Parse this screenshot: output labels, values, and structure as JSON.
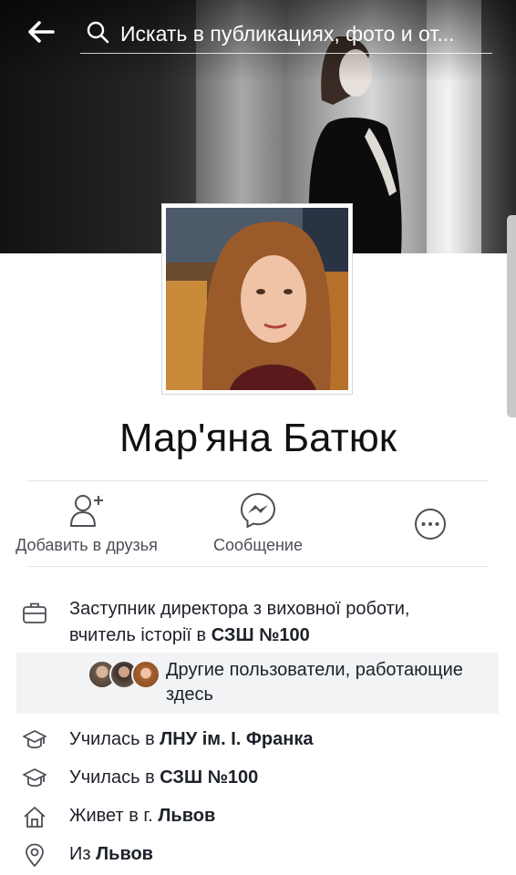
{
  "search": {
    "placeholder": "Искать в публикациях, фото и от..."
  },
  "profile": {
    "name": "Мар'яна Батюк"
  },
  "actions": {
    "add_friend": "Добавить в друзья",
    "message": "Сообщение"
  },
  "work": {
    "line1": "Заступник директора з виховної роботи,",
    "line2_prefix": "вчитель історії в ",
    "line2_place": "СЗШ №100",
    "coworkers_label": "Другие пользователи, работающие здесь"
  },
  "education": [
    {
      "prefix": "Училась в ",
      "place": "ЛНУ ім. І. Франка"
    },
    {
      "prefix": "Училась в ",
      "place": "СЗШ №100"
    }
  ],
  "lives": {
    "prefix": "Живет в г. ",
    "place": "Львов"
  },
  "from": {
    "prefix": "Из ",
    "place": "Львов"
  },
  "colors": {
    "icon": "#4b4f56",
    "messenger": "#4b4f56",
    "divider": "#e5e5e5"
  }
}
